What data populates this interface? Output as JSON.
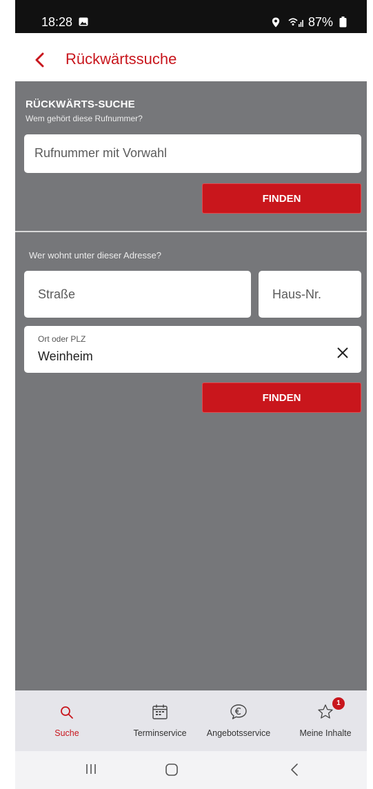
{
  "status_bar": {
    "time": "18:28",
    "battery": "87%"
  },
  "app_bar": {
    "title": "Rückwärtssuche"
  },
  "phone_search": {
    "title": "RÜCKWÄRTS-SUCHE",
    "subtitle": "Wem gehört diese Rufnummer?",
    "phone_placeholder": "Rufnummer mit Vorwahl",
    "find_button": "FINDEN"
  },
  "address_search": {
    "subtitle": "Wer wohnt unter dieser Adresse?",
    "street_placeholder": "Straße",
    "house_number_placeholder": "Haus-Nr.",
    "city_label": "Ort oder PLZ",
    "city_value": "Weinheim",
    "find_button": "FINDEN"
  },
  "bottom_nav": {
    "items": [
      {
        "label": "Suche",
        "icon": "search-icon",
        "active": true
      },
      {
        "label": "Terminservice",
        "icon": "calendar-icon",
        "active": false
      },
      {
        "label": "Angebotsservice",
        "icon": "euro-chat-icon",
        "active": false
      },
      {
        "label": "Meine Inhalte",
        "icon": "star-icon",
        "active": false,
        "badge": "1"
      }
    ]
  },
  "colors": {
    "accent": "#c8161d",
    "panel": "#76777a",
    "nav_background": "#e5e5ea"
  }
}
